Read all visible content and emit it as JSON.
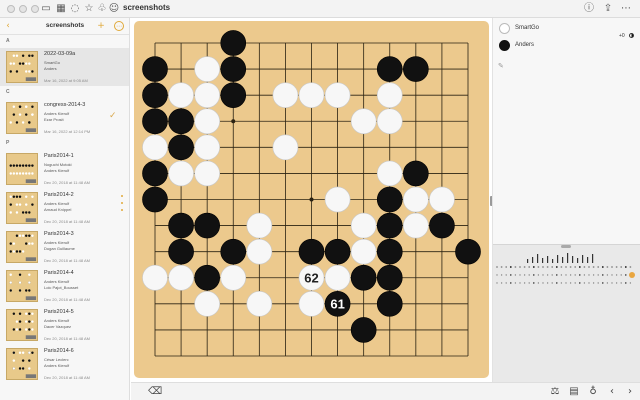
{
  "window": {
    "title": "screenshots",
    "title_icons": [
      "sidebar-toggle-icon",
      "grid-icon",
      "bulb-icon",
      "star-icon",
      "leaf-icon",
      "person-icon"
    ],
    "right_icons": [
      "info-icon",
      "share-icon",
      "more-icon"
    ]
  },
  "sidebar": {
    "title": "screenshots",
    "back_glyph": "‹",
    "add_glyph": "+",
    "more_glyph": "⋯",
    "sections": [
      {
        "letter": "A",
        "items": [
          {
            "name": "2022-03-09a",
            "lines": [
              "SmartGo",
              "Anders"
            ],
            "date": "Mar 16, 2022 at 9:05 AM",
            "selected": true,
            "check": false,
            "dots": false
          }
        ]
      },
      {
        "letter": "C",
        "items": [
          {
            "name": "congress-2014-3",
            "lines": [
              "Anders Kierulf",
              "Ezar Prosit"
            ],
            "date": "Mar 16, 2022 at 12:14 PM",
            "selected": false,
            "check": true,
            "dots": false
          }
        ]
      },
      {
        "letter": "P",
        "items": [
          {
            "name": "Paris2014-1",
            "lines": [
              "Noguchi Motoki",
              "Anders Kierulf"
            ],
            "date": "Dec 20, 2018 at 11:48 AM",
            "selected": false,
            "check": false,
            "dots": false
          },
          {
            "name": "Paris2014-2",
            "lines": [
              "Anders Kierulf",
              "Arnaud Knippel"
            ],
            "date": "Dec 20, 2018 at 11:48 AM",
            "selected": false,
            "check": false,
            "dots": true
          },
          {
            "name": "Paris2014-3",
            "lines": [
              "Anders Kierulf",
              "Dugan Guillaume"
            ],
            "date": "Dec 20, 2018 at 11:48 AM",
            "selected": false,
            "check": false,
            "dots": false
          },
          {
            "name": "Paris2014-4",
            "lines": [
              "Anders Kierulf",
              "Loic Pajot_Bousset"
            ],
            "date": "Dec 20, 2018 at 11:48 AM",
            "selected": false,
            "check": false,
            "dots": false
          },
          {
            "name": "Paris2014-5",
            "lines": [
              "Anders Kierulf",
              "Dacer Vazquez"
            ],
            "date": "Dec 20, 2018 at 11:48 AM",
            "selected": false,
            "check": false,
            "dots": false
          },
          {
            "name": "Paris2014-6",
            "lines": [
              "César Leclerc",
              "Anders Kierulf"
            ],
            "date": "Dec 20, 2018 at 11:48 AM",
            "selected": false,
            "check": false,
            "dots": false
          }
        ]
      }
    ]
  },
  "players": [
    {
      "name": "SmartGo",
      "color": "white",
      "captures": "+0"
    },
    {
      "name": "Anders",
      "color": "black",
      "captures": "+0"
    }
  ],
  "board": {
    "size": 13,
    "black": [
      [
        1,
        2
      ],
      [
        4,
        2
      ],
      [
        10,
        2
      ],
      [
        11,
        2
      ],
      [
        1,
        3
      ],
      [
        4,
        3
      ],
      [
        1,
        4
      ],
      [
        2,
        4
      ],
      [
        2,
        5
      ],
      [
        1,
        6
      ],
      [
        11,
        6
      ],
      [
        1,
        7
      ],
      [
        10,
        7
      ],
      [
        2,
        8
      ],
      [
        3,
        8
      ],
      [
        10,
        8
      ],
      [
        12,
        8
      ],
      [
        2,
        9
      ],
      [
        4,
        9
      ],
      [
        7,
        9
      ],
      [
        8,
        9
      ],
      [
        10,
        9
      ],
      [
        13,
        9
      ],
      [
        3,
        10
      ],
      [
        9,
        10
      ],
      [
        10,
        10
      ],
      [
        10,
        11
      ],
      [
        9,
        12
      ]
    ],
    "white": [
      [
        3,
        2
      ],
      [
        3,
        3
      ],
      [
        2,
        3
      ],
      [
        7,
        3
      ],
      [
        8,
        3
      ],
      [
        6,
        3
      ],
      [
        10,
        3
      ],
      [
        9,
        4
      ],
      [
        10,
        4
      ],
      [
        3,
        4
      ],
      [
        1,
        5
      ],
      [
        3,
        5
      ],
      [
        6,
        5
      ],
      [
        2,
        6
      ],
      [
        3,
        6
      ],
      [
        10,
        6
      ],
      [
        8,
        7
      ],
      [
        11,
        7
      ],
      [
        12,
        7
      ],
      [
        5,
        8
      ],
      [
        11,
        8
      ],
      [
        5,
        9
      ],
      [
        9,
        8
      ],
      [
        9,
        9
      ],
      [
        1,
        10
      ],
      [
        2,
        10
      ],
      [
        4,
        10
      ],
      [
        8,
        10
      ],
      [
        3,
        11
      ],
      [
        5,
        11
      ],
      [
        7,
        11
      ]
    ],
    "extra_black": [
      [
        4,
        1
      ]
    ],
    "numbered": [
      {
        "point": [
          7,
          10
        ],
        "label": "62",
        "color": "white"
      },
      {
        "point": [
          8,
          11
        ],
        "label": "61",
        "color": "black"
      }
    ],
    "star_points": [
      [
        4,
        4
      ],
      [
        10,
        4
      ],
      [
        4,
        10
      ],
      [
        10,
        10
      ],
      [
        7,
        7
      ]
    ]
  },
  "toolbar": {
    "left_icon": "back-arrow-icon",
    "right_icons": [
      "mode-icon",
      "book-icon",
      "bulb-icon",
      "rewind-icon",
      "forward-icon"
    ]
  }
}
